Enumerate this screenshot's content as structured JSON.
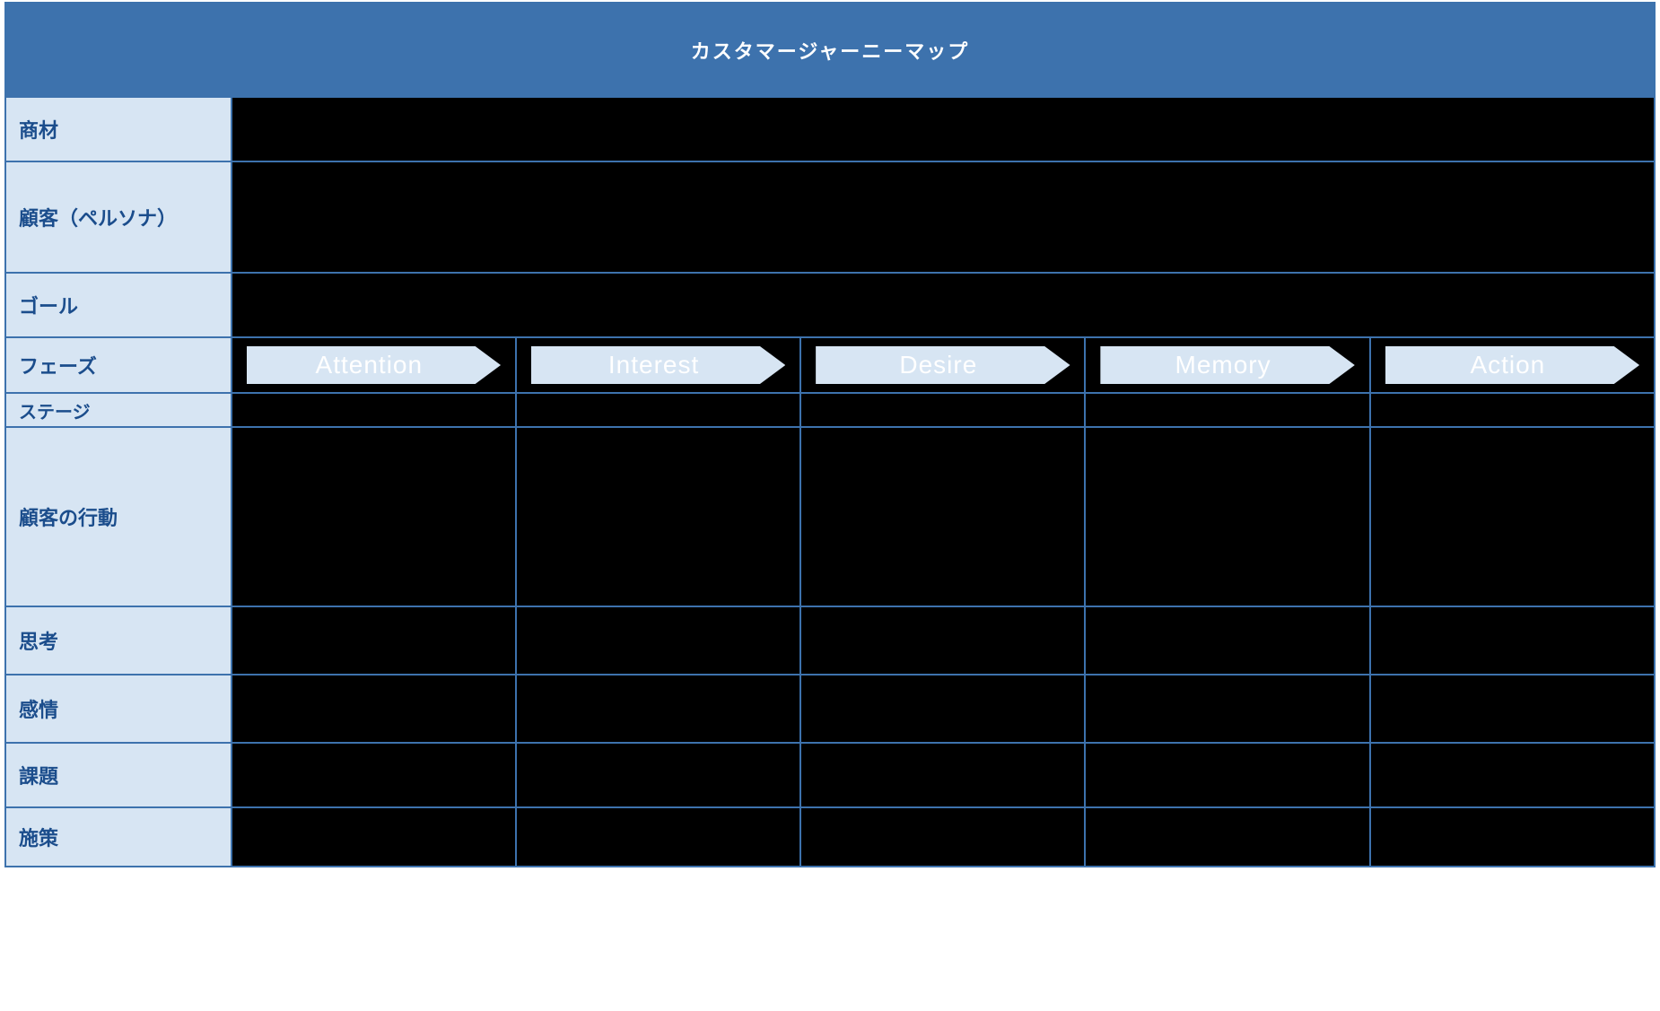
{
  "title": "カスタマージャーニーマップ",
  "rows": {
    "shozai": "商材",
    "persona": "顧客（ペルソナ）",
    "goal": "ゴール",
    "phase": "フェーズ",
    "stage": "ステージ",
    "behavior": "顧客の行動",
    "thought": "思考",
    "feeling": "感情",
    "issue": "課題",
    "measure": "施策"
  },
  "phases": [
    "Attention",
    "Interest",
    "Desire",
    "Memory",
    "Action"
  ],
  "colors": {
    "header_bg": "#3d72ad",
    "label_bg": "#d7e5f3",
    "label_fg": "#1b4d8c",
    "content_bg": "#000000",
    "arrow_bg": "#d7e5f3",
    "arrow_fg": "#ffffff",
    "border": "#3d72ad"
  }
}
